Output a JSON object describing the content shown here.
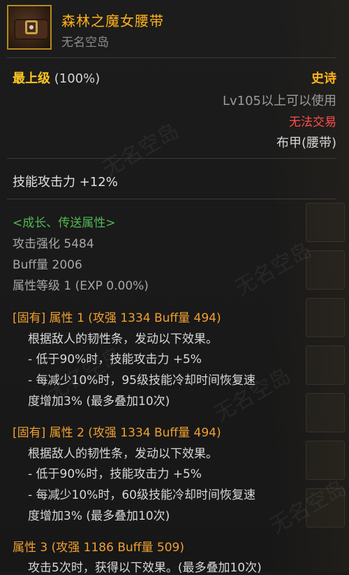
{
  "item": {
    "name": "森林之魔女腰带",
    "source": "无名空岛",
    "tier_label": "最上级",
    "tier_pct": "(100%)",
    "rarity": "史诗",
    "requirement": "Lv105以上可以使用",
    "trade": "无法交易",
    "type": "布甲(腰带)",
    "skill_attack": "技能攻击力 +12%"
  },
  "growth": {
    "title": "<成长、传送属性>",
    "attack_strength": "攻击强化 5484",
    "buff_amount": "Buff量 2006",
    "attr_level": "属性等级 1 (EXP 0.00%)"
  },
  "options": [
    {
      "title": "[固有] 属性 1 (攻强 1334  Buff量 494)",
      "lines": [
        "根据敌人的韧性条，发动以下效果。",
        "- 低于90%时，技能攻击力 +5%",
        "- 每减少10%时，95级技能冷却时间恢复速",
        "度增加3% (最多叠加10次)"
      ]
    },
    {
      "title": "[固有] 属性 2 (攻强 1334  Buff量 494)",
      "lines": [
        "根据敌人的韧性条，发动以下效果。",
        "- 低于90%时，技能攻击力 +5%",
        "- 每减少10%时，60级技能冷却时间恢复速",
        "度增加3% (最多叠加10次)"
      ]
    },
    {
      "title": "属性 3 (攻强 1186  Buff量 509)",
      "lines": [
        "攻击5次时，获得以下效果。(最多叠加10次)"
      ]
    }
  ],
  "watermark": "无名空岛",
  "icon": "belt-icon"
}
